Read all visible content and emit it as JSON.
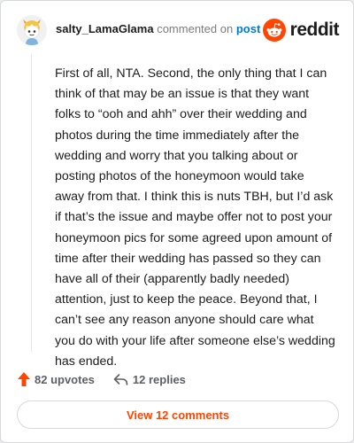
{
  "author": {
    "username": "salty_LamaGlama",
    "action_text": "commented on",
    "post_link": "post",
    "avatar_icon": "snoo-avatar-icon"
  },
  "brand": {
    "name": "reddit",
    "color": "#ff4500"
  },
  "comment": {
    "body": "First of all, NTA. Second, the only thing that I can think of that may be an issue is that they want folks to “ooh and ahh” over their wedding and photos during the time immediately after the wedding and worry that you talking about or posting photos of the honeymoon would take away from that. I think this is nuts TBH, but I’d ask if that’s the issue and maybe offer not to post your honeymoon pics for some agreed upon amount of time after their wedding has passed so they can have all of their (apparently badly needed) attention, just to keep the peace. Beyond that, I can’t see any reason anyone should care what you do with your life after someone else’s wedding has ended."
  },
  "actions": {
    "upvotes": "82 upvotes",
    "upvote_icon": "upvote-arrow-icon",
    "replies": "12 replies",
    "reply_icon": "reply-arrow-icon"
  },
  "footer": {
    "view_comments": "View 12 comments"
  }
}
